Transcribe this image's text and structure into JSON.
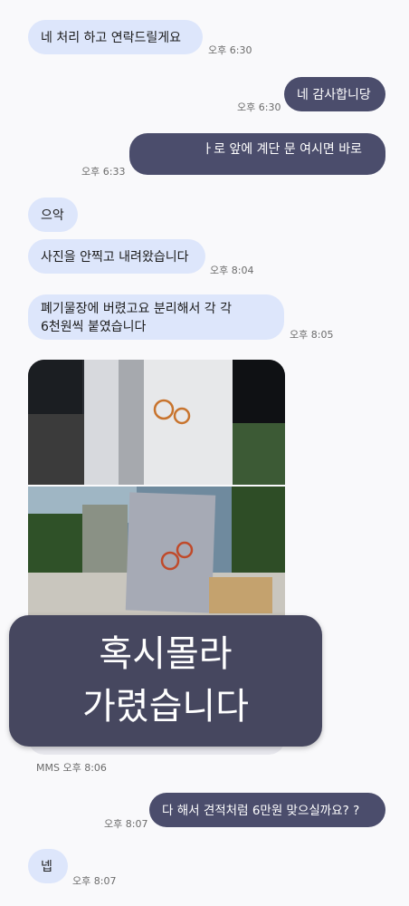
{
  "messages": [
    {
      "text": "네 처리 하고 연락드릴게요",
      "time": "오후 6:30"
    },
    {
      "text": "네 감사합니당",
      "time": "오후 6:30"
    },
    {
      "text": "ㅏ로 앞에 계단 문 여시면 바로",
      "time": "오후 6:33"
    },
    {
      "text": "으악"
    },
    {
      "text": "사진을 안찍고 내려왔습니다",
      "time": "오후 8:04"
    },
    {
      "text": "폐기물장에 버렸고요  분리해서  각 각\n6천원씩 붙였습니다",
      "time": "오후 8:05"
    },
    {
      "text": "다 해서 견적처럼 6만원 맞으실까요? ?",
      "time": "오후 8:07"
    },
    {
      "text": "넵",
      "time": "오후 8:07"
    }
  ],
  "mms": {
    "label": "MMS 오후 8:06"
  },
  "overlay": {
    "text": "혹시몰라\n가렸습니다"
  },
  "colors": {
    "incoming": "#dde6fb",
    "outgoing": "#4b4d6c",
    "background": "#f9f9fb"
  }
}
